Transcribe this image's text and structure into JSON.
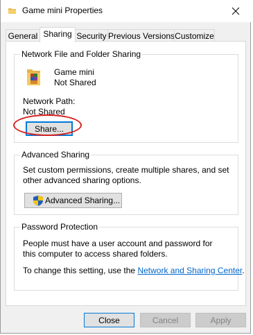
{
  "window": {
    "title": "Game mini Properties",
    "close_glyph": "✕"
  },
  "tabs": [
    {
      "label": "General",
      "active": false
    },
    {
      "label": "Sharing",
      "active": true
    },
    {
      "label": "Security",
      "active": false
    },
    {
      "label": "Previous Versions",
      "active": false
    },
    {
      "label": "Customize",
      "active": false
    }
  ],
  "network_sharing": {
    "group_title": "Network File and Folder Sharing",
    "folder_name": "Game mini",
    "folder_status": "Not Shared",
    "path_label": "Network Path:",
    "path_value": "Not Shared",
    "share_button": "Share..."
  },
  "advanced_sharing": {
    "group_title": "Advanced Sharing",
    "description": "Set custom permissions, create multiple shares, and set other advanced sharing options.",
    "button": "Advanced Sharing..."
  },
  "password_protection": {
    "group_title": "Password Protection",
    "description": "People must have a user account and password for this computer to access shared folders.",
    "change_prefix": "To change this setting, use the ",
    "link_text": "Network and Sharing Center",
    "change_suffix": "."
  },
  "footer": {
    "close": "Close",
    "cancel": "Cancel",
    "apply": "Apply"
  },
  "colors": {
    "accent": "#0078d7",
    "annotation": "#d81e1e",
    "link": "#0066cc"
  }
}
